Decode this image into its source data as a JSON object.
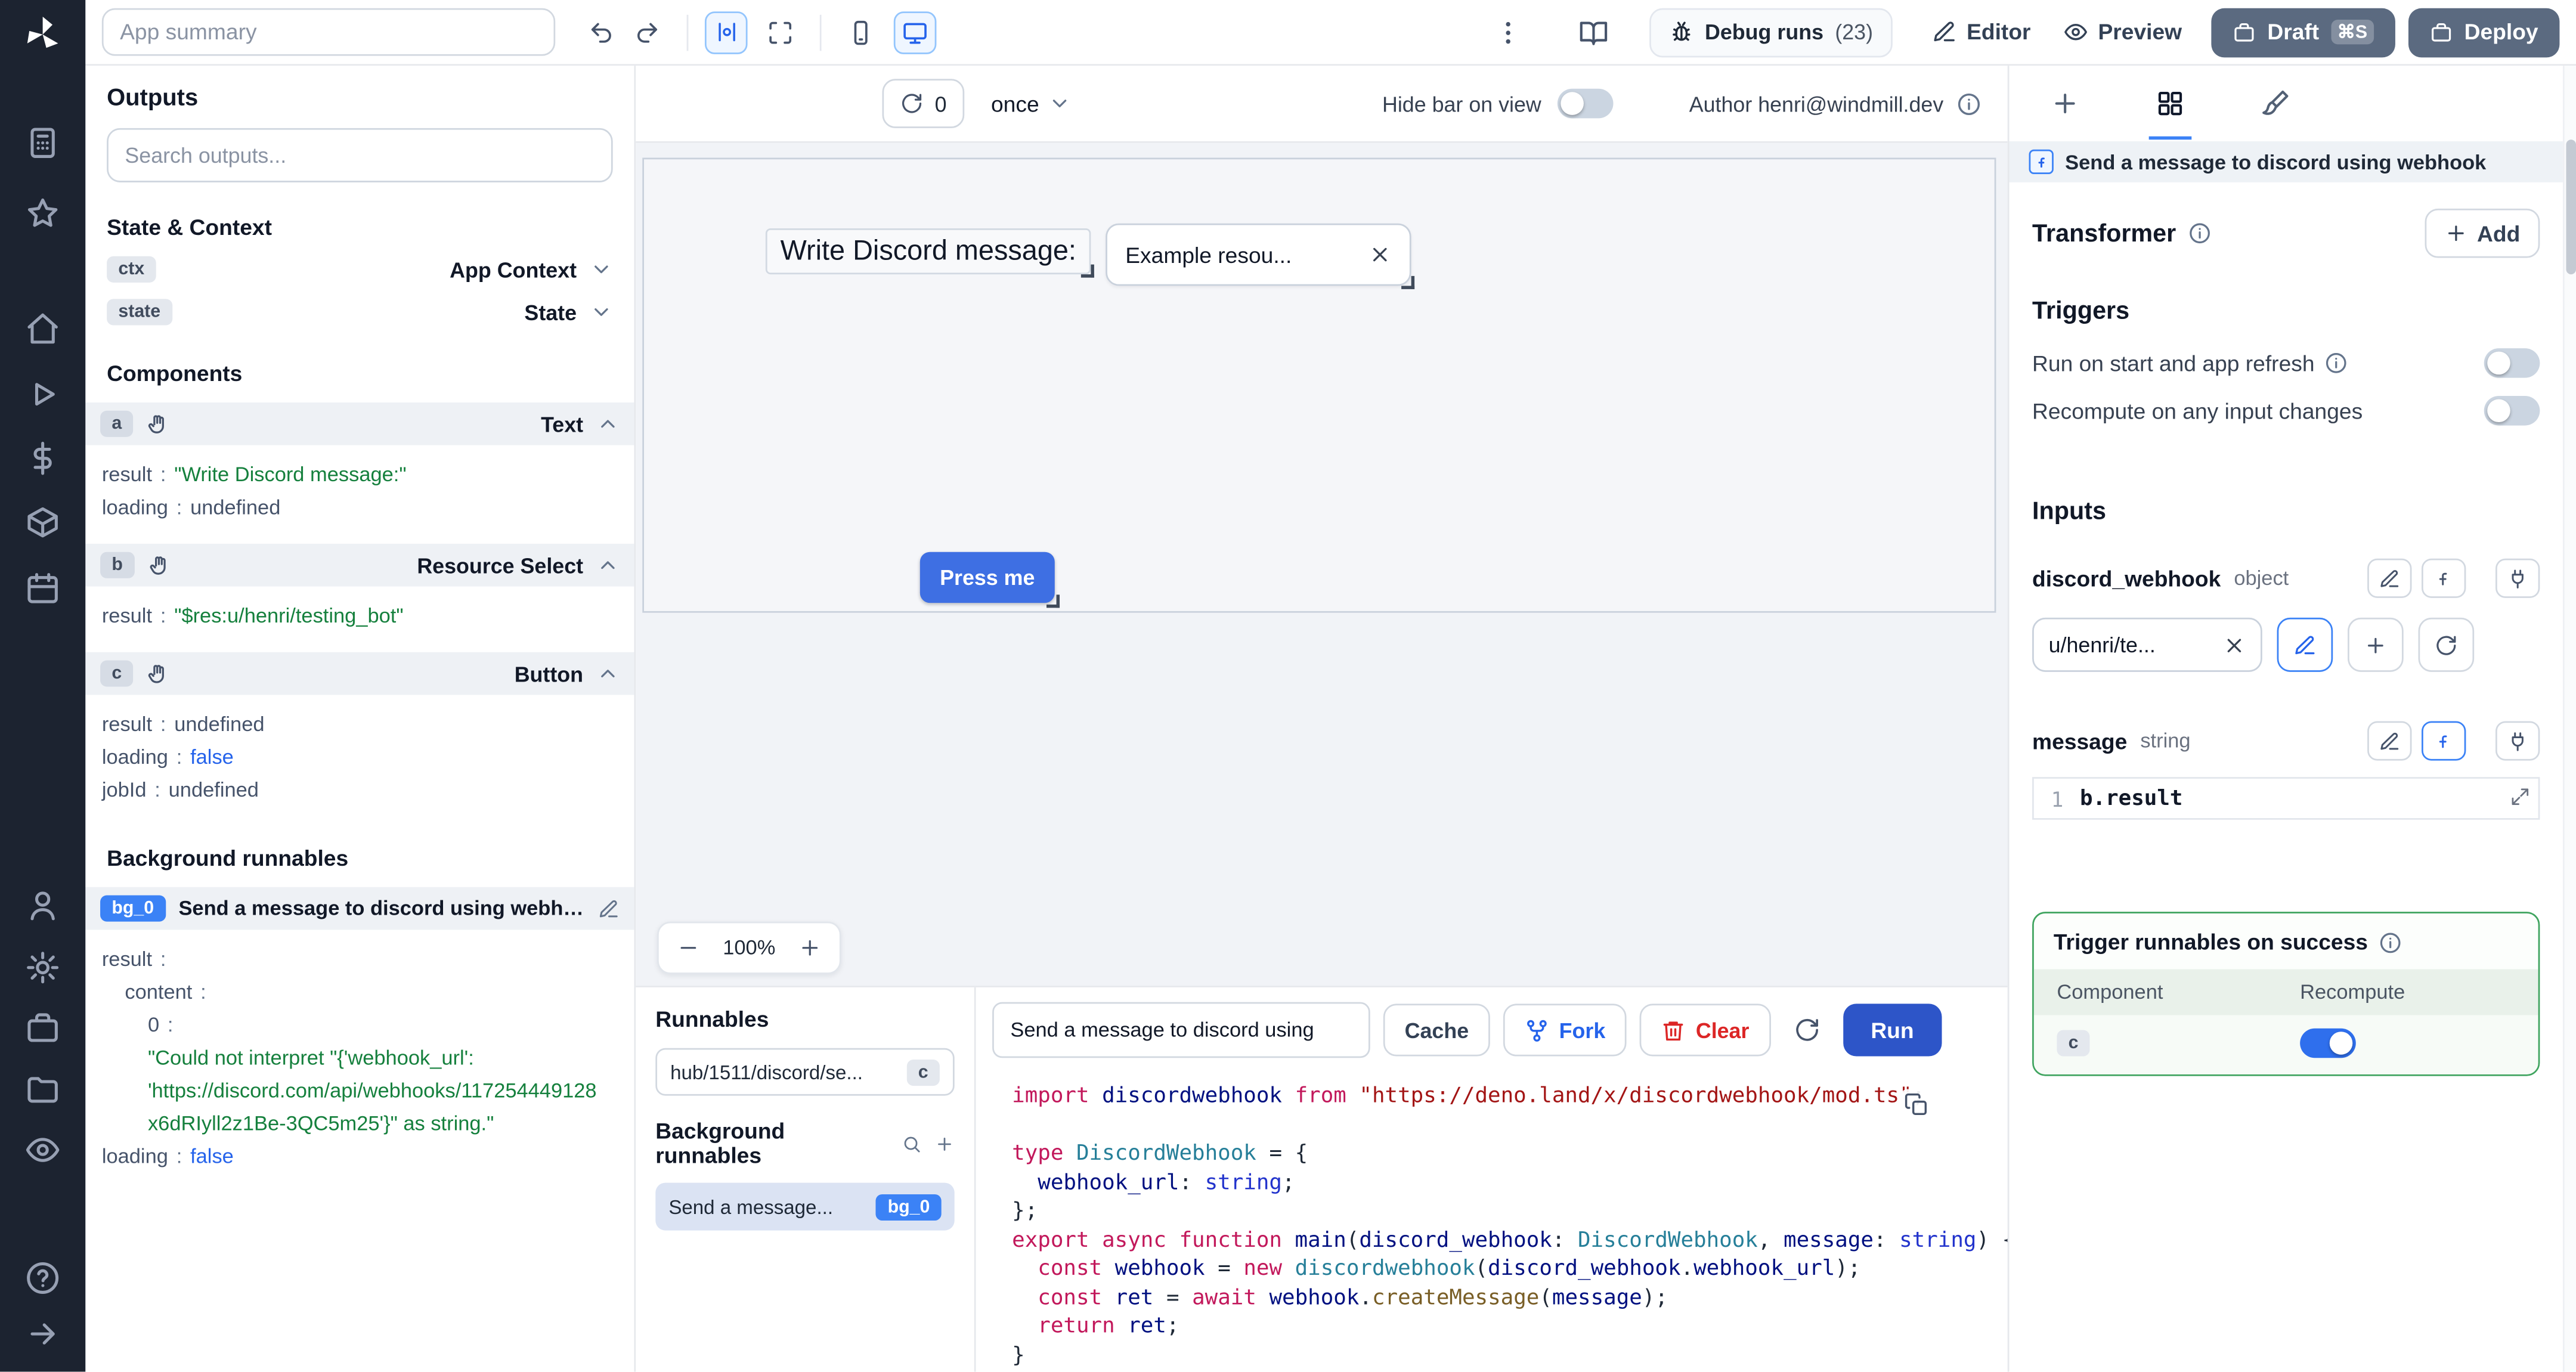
{
  "topbar": {
    "app_summary": "App summary",
    "debug_label": "Debug runs",
    "debug_count": "(23)",
    "editor": "Editor",
    "preview": "Preview",
    "draft": "Draft",
    "draft_kbd": "⌘S",
    "deploy": "Deploy"
  },
  "outputs": {
    "title": "Outputs",
    "search_placeholder": "Search outputs...",
    "state_context": "State & Context",
    "sep": ":",
    "ctx": {
      "badge": "ctx",
      "label": "App Context"
    },
    "state": {
      "badge": "state",
      "label": "State"
    },
    "components_title": "Components",
    "comp_a": {
      "badge": "a",
      "type": "Text",
      "r1k": "result",
      "r1v": "\"Write Discord message:\"",
      "r2k": "loading",
      "r2v": "undefined"
    },
    "comp_b": {
      "badge": "b",
      "type": "Resource Select",
      "r1k": "result",
      "r1v": "\"$res:u/henri/testing_bot\""
    },
    "comp_c": {
      "badge": "c",
      "type": "Button",
      "r1k": "result",
      "r1v": "undefined",
      "r2k": "loading",
      "r2v": "false",
      "r3k": "jobId",
      "r3v": "undefined"
    },
    "bg_title": "Background runnables",
    "bg": {
      "badge": "bg_0",
      "name": "Send a message to discord using webhook",
      "k_result": "result",
      "k_content": "content",
      "k_zero": "0",
      "err1": "\"Could not interpret \"{'webhook_url':",
      "err2": "'https://discord.com/api/webhooks/117254449128",
      "err3": "x6dRIyll2z1Be-3QC5m25'}\" as string.\"",
      "k_loading": "loading",
      "v_loading": "false"
    }
  },
  "canvas": {
    "refresh_count": "0",
    "mode": "once",
    "hide_bar": "Hide bar on view",
    "author": "Author henri@windmill.dev",
    "text_component": "Write Discord message:",
    "select_value": "Example resou...",
    "button_label": "Press me",
    "zoom": "100%"
  },
  "runnables": {
    "title": "Runnables",
    "main_item": "hub/1511/discord/se...",
    "main_badge": "c",
    "bg_title": "Background runnables",
    "bg_item": "Send a message...",
    "bg_badge": "bg_0"
  },
  "editor": {
    "title": "Send a message to discord using",
    "cache": "Cache",
    "fork": "Fork",
    "clear": "Clear",
    "run": "Run",
    "code": [
      [
        [
          "kw",
          "import "
        ],
        [
          "vr",
          "discordwebhook"
        ],
        [
          "kw",
          " from "
        ],
        [
          "st",
          "\"https://deno.land/x/discordwebhook/mod.ts\""
        ],
        [
          "pl",
          ";"
        ]
      ],
      [],
      [
        [
          "kw",
          "type "
        ],
        [
          "ty",
          "DiscordWebhook"
        ],
        [
          "pl",
          " = {"
        ]
      ],
      [
        [
          "pl",
          "  "
        ],
        [
          "vr",
          "webhook_url"
        ],
        [
          "pl",
          ": "
        ],
        [
          "kb",
          "string"
        ],
        [
          "pl",
          ";"
        ]
      ],
      [
        [
          "pl",
          "};"
        ]
      ],
      [
        [
          "kw",
          "export async function "
        ],
        [
          "vr",
          "main"
        ],
        [
          "pl",
          "("
        ],
        [
          "vr",
          "discord_webhook"
        ],
        [
          "pl",
          ": "
        ],
        [
          "ty",
          "DiscordWebhook"
        ],
        [
          "pl",
          ", "
        ],
        [
          "vr",
          "message"
        ],
        [
          "pl",
          ": "
        ],
        [
          "kb",
          "string"
        ],
        [
          "pl",
          ") {"
        ]
      ],
      [
        [
          "pl",
          "  "
        ],
        [
          "kw",
          "const "
        ],
        [
          "vr",
          "webhook"
        ],
        [
          "pl",
          " = "
        ],
        [
          "kw",
          "new "
        ],
        [
          "ty",
          "discordwebhook"
        ],
        [
          "pl",
          "("
        ],
        [
          "vr",
          "discord_webhook"
        ],
        [
          "pl",
          "."
        ],
        [
          "vr",
          "webhook_url"
        ],
        [
          "pl",
          ");"
        ]
      ],
      [
        [
          "pl",
          "  "
        ],
        [
          "kw",
          "const "
        ],
        [
          "vr",
          "ret"
        ],
        [
          "pl",
          " = "
        ],
        [
          "kw",
          "await "
        ],
        [
          "vr",
          "webhook"
        ],
        [
          "pl",
          "."
        ],
        [
          "fn",
          "createMessage"
        ],
        [
          "pl",
          "("
        ],
        [
          "vr",
          "message"
        ],
        [
          "pl",
          ");"
        ]
      ],
      [
        [
          "pl",
          "  "
        ],
        [
          "kw",
          "return "
        ],
        [
          "vr",
          "ret"
        ],
        [
          "pl",
          ";"
        ]
      ],
      [
        [
          "pl",
          "}"
        ]
      ]
    ]
  },
  "panel": {
    "header": "Send a message to discord using webhook",
    "transformer": "Transformer",
    "add": "Add",
    "triggers": "Triggers",
    "trigger1": "Run on start and app refresh",
    "trigger2": "Recompute on any input changes",
    "inputs": "Inputs",
    "dw_name": "discord_webhook",
    "dw_type": "object",
    "dw_value": "u/henri/te...",
    "msg_name": "message",
    "msg_type": "string",
    "msg_line": "1",
    "msg_code": "b.result",
    "ts_title": "Trigger runnables on success",
    "ts_col1": "Component",
    "ts_col2": "Recompute",
    "ts_badge": "c"
  }
}
